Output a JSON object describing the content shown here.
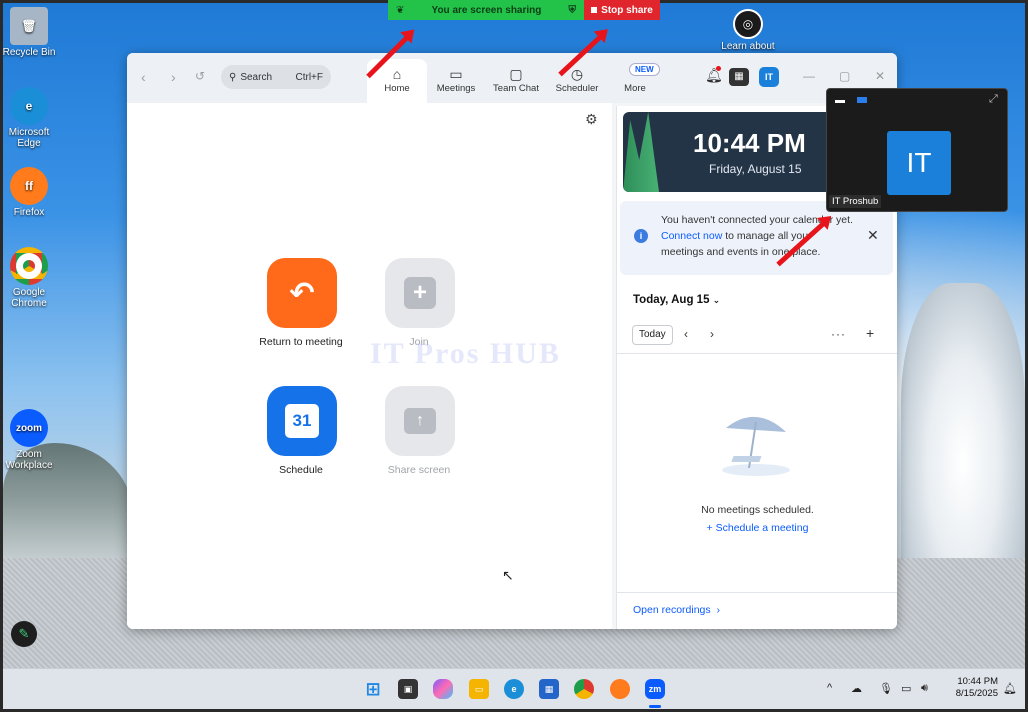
{
  "desktop": {
    "icons": [
      {
        "label": "Recycle Bin",
        "icon": "recycle-bin-icon",
        "color": "#a6b6c6"
      },
      {
        "label": "Microsoft Edge",
        "icon": "edge-icon",
        "color": "#1a8fd8"
      },
      {
        "label": "Firefox",
        "icon": "firefox-icon",
        "color": "#ff7b1c"
      },
      {
        "label": "Google Chrome",
        "icon": "chrome-icon",
        "color": "#dd3a2f"
      },
      {
        "label": "Zoom Workplace",
        "icon": "zoom-icon",
        "color": "#0b5cff"
      },
      {
        "label": "Learn about",
        "icon": "learn-about-icon",
        "color": "#1b1b1b"
      }
    ],
    "zoom_icon_text": "zoom"
  },
  "share_bar": {
    "status": "You are screen sharing",
    "stop": "Stop share",
    "green_color": "#23c34a",
    "red_color": "#e0262c"
  },
  "zoom": {
    "search_label": "Search",
    "search_shortcut": "Ctrl+F",
    "tabs": [
      {
        "label": "Home",
        "icon": "home-icon",
        "glyph": "⌂"
      },
      {
        "label": "Meetings",
        "icon": "video-camera-icon",
        "glyph": "▭"
      },
      {
        "label": "Team Chat",
        "icon": "chat-bubble-icon",
        "glyph": "▢"
      },
      {
        "label": "Scheduler",
        "icon": "calendar-clock-icon",
        "glyph": "◷"
      },
      {
        "label": "More",
        "icon": "more-dots-icon",
        "glyph": "·"
      }
    ],
    "new_badge": "NEW",
    "home": {
      "buttons": [
        {
          "label": "Return to meeting",
          "icon": "return-arrow-icon",
          "glyph": "↶",
          "color": "#ff6a1a"
        },
        {
          "label": "Join",
          "icon": "plus-icon",
          "glyph": "+",
          "color": "#e5e7ea"
        },
        {
          "label": "Schedule",
          "icon": "calendar-icon",
          "glyph": "31",
          "color": "#1572e8"
        },
        {
          "label": "Share screen",
          "icon": "share-arrow-up-icon",
          "glyph": "↑",
          "color": "#e5e7ea"
        }
      ]
    },
    "clock": {
      "time": "10:44 PM",
      "date": "Friday, August 15"
    },
    "notice": {
      "part1": "You haven't connected your calendar yet. ",
      "link": "Connect now",
      "part2": " to manage all your meetings and events in one place."
    },
    "calendar": {
      "header": "Today, Aug 15",
      "today_btn": "Today",
      "empty": "No meetings scheduled.",
      "schedule_link": "Schedule a meeting",
      "open_recordings": "Open recordings"
    }
  },
  "video_float": {
    "initials": "IT",
    "name": "IT Proshub"
  },
  "watermark": "IT Pros HUB",
  "taskbar": {
    "apps": [
      {
        "icon": "windows-start-icon",
        "color": "#1e88e5"
      },
      {
        "icon": "task-view-icon",
        "color": "#333333"
      },
      {
        "icon": "copilot-icon",
        "color": "#7b5cff"
      },
      {
        "icon": "file-explorer-icon",
        "color": "#f4b400"
      },
      {
        "icon": "edge-icon",
        "color": "#1a8fd8"
      },
      {
        "icon": "microsoft-store-icon",
        "color": "#2465c9"
      },
      {
        "icon": "chrome-icon",
        "color": "#dd3a2f"
      },
      {
        "icon": "firefox-icon",
        "color": "#ff7b1c"
      },
      {
        "icon": "zoom-icon",
        "color": "#0b5cff"
      }
    ],
    "zoom_label": "zm",
    "time": "10:44 PM",
    "date": "8/15/2025"
  }
}
